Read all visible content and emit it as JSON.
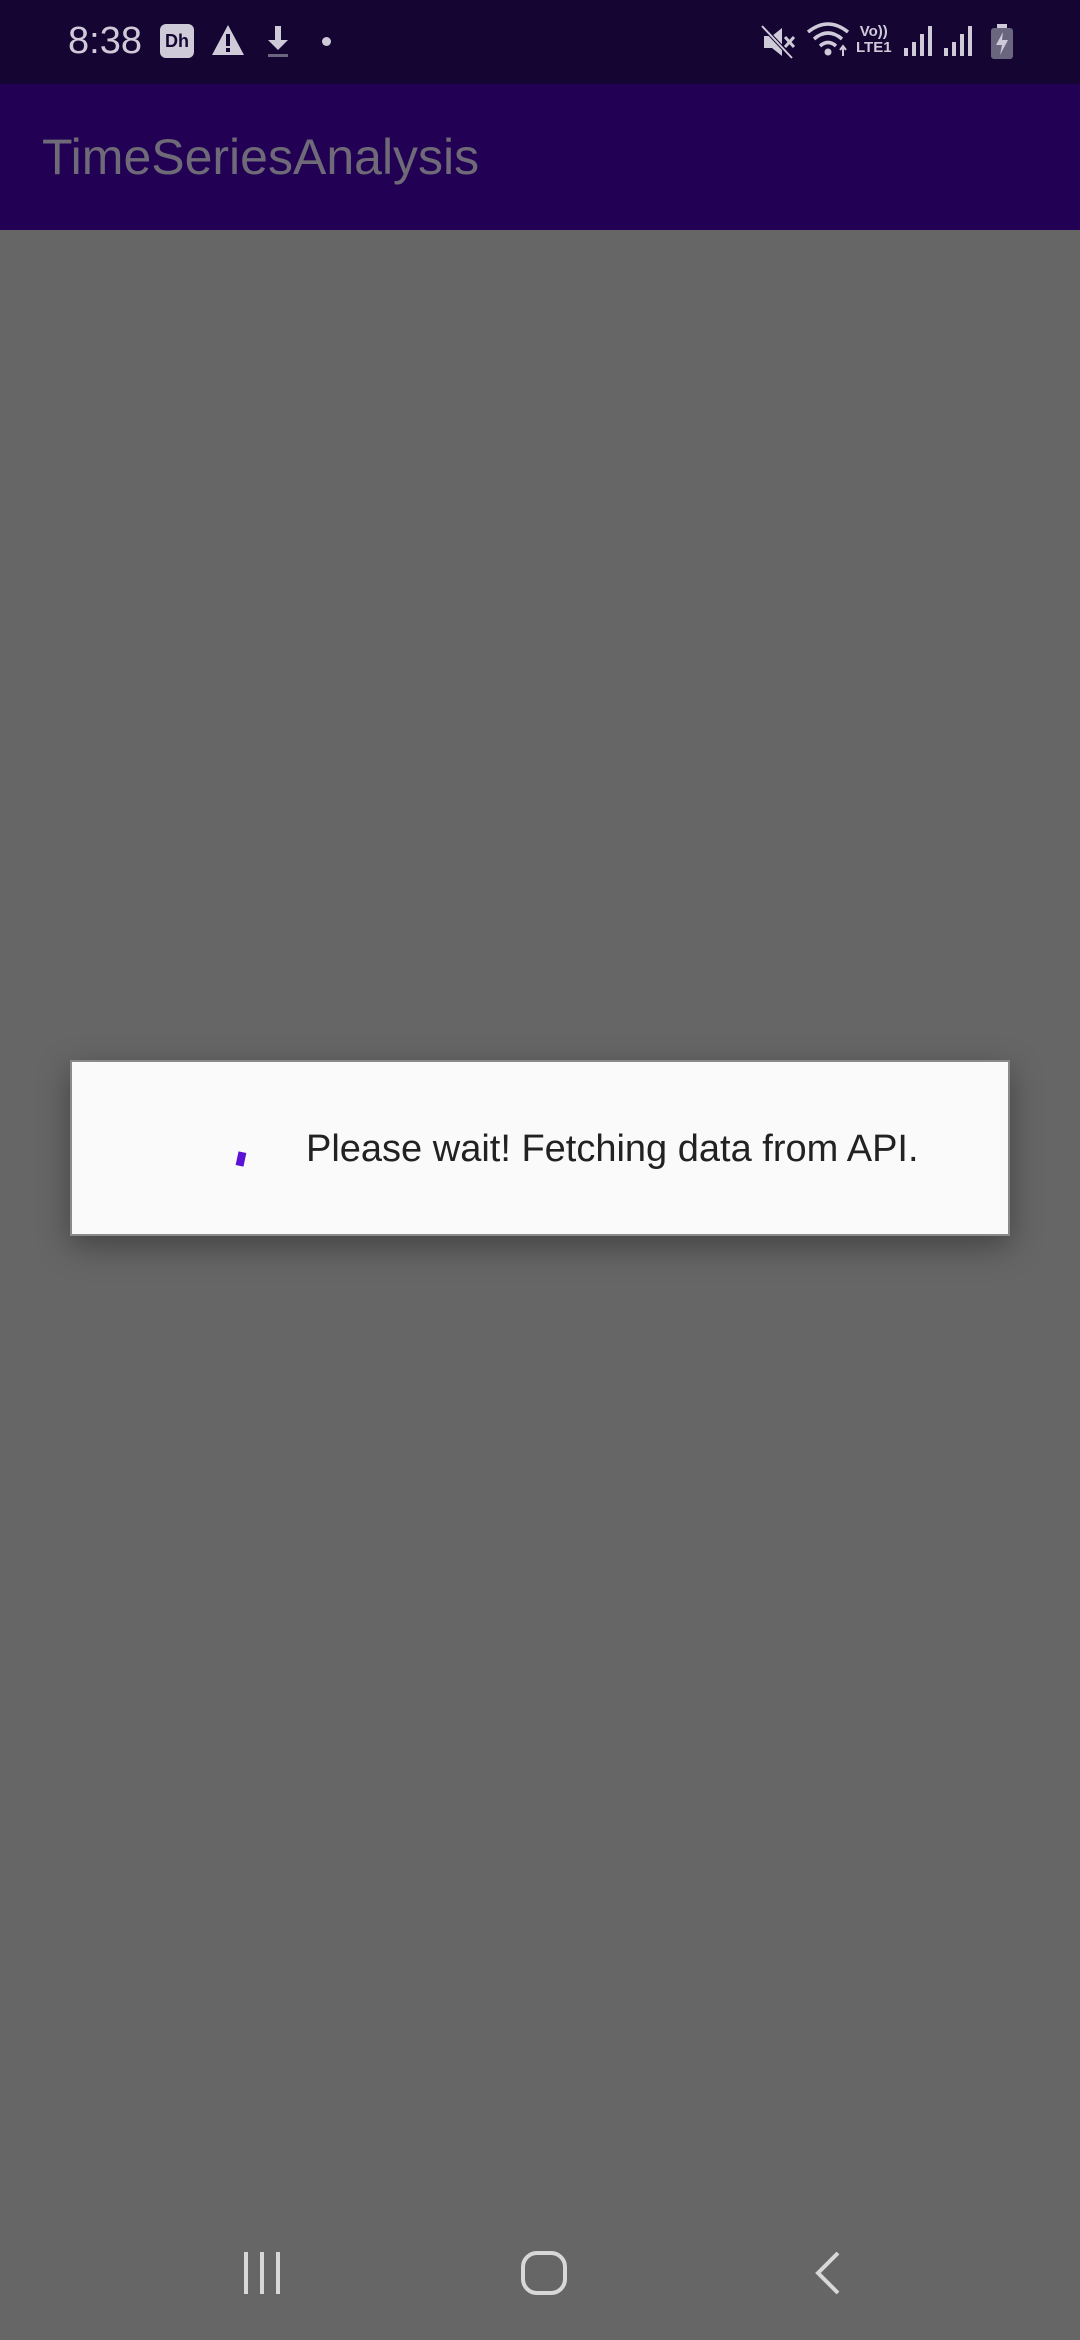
{
  "status_bar": {
    "time": "8:38",
    "left_icons": [
      "disney-hotstar-icon",
      "warning-icon",
      "download-icon",
      "notification-dot-icon"
    ],
    "volte_top": "Vo))",
    "volte_bottom": "LTE1",
    "right_icons": [
      "mute-icon",
      "wifi-icon",
      "volte-lte-icon",
      "signal-icon",
      "signal-icon",
      "battery-charging-icon"
    ]
  },
  "app_bar": {
    "title": "TimeSeriesAnalysis"
  },
  "dialog": {
    "message": "Please wait! Fetching data from API.",
    "spinner_color": "#5a12d6"
  },
  "nav_bar": {
    "icons": [
      "recents-icon",
      "home-icon",
      "back-icon"
    ]
  },
  "colors": {
    "status_bar_bg": "#140533",
    "app_bar_bg": "#220054",
    "scrim": "#666666",
    "dialog_bg": "#fafafa"
  }
}
